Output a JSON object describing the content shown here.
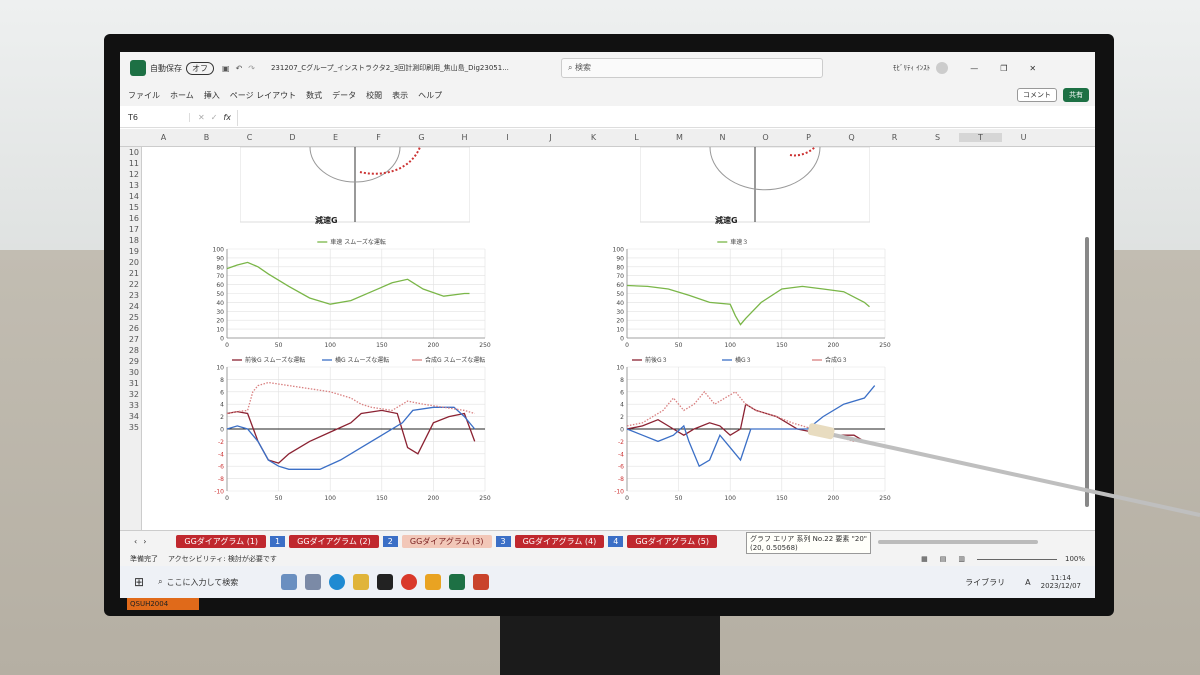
{
  "window": {
    "autosave_label": "自動保存",
    "autosave_state": "オフ",
    "file_name": "231207_Cグループ_インストラクタ2_3回計測印刷用_焦山島_Dig23051...",
    "search_placeholder": "検索",
    "user_name": "ﾓﾋﾞﾘﾃｨ ｲﾝｽﾄ",
    "comment_button": "コメント",
    "share_button": "共有"
  },
  "menu": [
    "ファイル",
    "ホーム",
    "挿入",
    "ページ レイアウト",
    "数式",
    "データ",
    "校閲",
    "表示",
    "ヘルプ"
  ],
  "formula_bar": {
    "name_box": "T6",
    "fx": "fx"
  },
  "columns": [
    "A",
    "B",
    "C",
    "D",
    "E",
    "F",
    "G",
    "H",
    "I",
    "J",
    "K",
    "L",
    "M",
    "N",
    "O",
    "P",
    "Q",
    "R",
    "S",
    "T",
    "U"
  ],
  "rows": [
    "10",
    "11",
    "12",
    "13",
    "14",
    "15",
    "16",
    "17",
    "18",
    "19",
    "20",
    "21",
    "22",
    "23",
    "24",
    "25",
    "26",
    "27",
    "28",
    "29",
    "30",
    "31",
    "32",
    "33",
    "34",
    "35"
  ],
  "charts_labels": {
    "decel_left": "減速G",
    "decel_right": "減速G",
    "speed_left_legend": "車速 スムーズな運転",
    "speed_right_legend": "車速３",
    "g_left_legend": [
      "前後G スムーズな運転",
      "横G スムーズな運転",
      "合成G スムーズな運転"
    ],
    "g_right_legend": [
      "前後G３",
      "横G３",
      "合成G３"
    ]
  },
  "sheet_tabs": [
    {
      "label": "GGダイアグラム (1)",
      "kind": "red"
    },
    {
      "label": "1",
      "kind": "blue"
    },
    {
      "label": "GGダイアグラム (2)",
      "kind": "red"
    },
    {
      "label": "2",
      "kind": "blue"
    },
    {
      "label": "GGダイアグラム (3)",
      "kind": "active"
    },
    {
      "label": "3",
      "kind": "blue"
    },
    {
      "label": "GGダイアグラム (4)",
      "kind": "red"
    },
    {
      "label": "4",
      "kind": "blue"
    },
    {
      "label": "GGダイアグラム (5)",
      "kind": "red"
    }
  ],
  "tooltip": {
    "line1": "グラフ エリア 系列 No.22 要素 \"20\"",
    "line2": "(20, 0.50568)"
  },
  "status": {
    "ready": "準備完了",
    "accessibility": "アクセシビリティ: 検討が必要です",
    "zoom": "100%"
  },
  "taskbar": {
    "search_placeholder": "ここに入力して検索",
    "library": "ライブラリ",
    "time": "11:14",
    "date": "2023/12/07",
    "ime": "A"
  },
  "badge": "QSUH2004",
  "colors": {
    "speed": "#7ab648",
    "longitudinal": "#8b2232",
    "lateral": "#3b6fc6",
    "combined": "#d98080"
  },
  "chart_data": [
    {
      "type": "line",
      "title": "",
      "series": [
        {
          "name": "車速 スムーズな運転",
          "x": [
            0,
            10,
            20,
            30,
            40,
            60,
            80,
            100,
            120,
            140,
            160,
            175,
            190,
            210,
            230,
            235
          ],
          "y": [
            78,
            82,
            85,
            80,
            72,
            58,
            45,
            38,
            42,
            52,
            62,
            66,
            55,
            47,
            50,
            50
          ]
        }
      ],
      "xlim": [
        0,
        250
      ],
      "ylim": [
        0,
        100
      ],
      "xticks": [
        0,
        50,
        100,
        150,
        200,
        250
      ],
      "yticks": [
        0,
        10,
        20,
        30,
        40,
        50,
        60,
        70,
        80,
        90,
        100
      ]
    },
    {
      "type": "line",
      "title": "",
      "series": [
        {
          "name": "前後G スムーズな運転",
          "x": [
            0,
            10,
            20,
            30,
            40,
            50,
            60,
            80,
            100,
            120,
            130,
            150,
            165,
            175,
            185,
            200,
            215,
            230,
            240
          ],
          "y": [
            2.5,
            2.8,
            2.5,
            -2,
            -5,
            -5.5,
            -4,
            -2,
            -0.5,
            1,
            2.5,
            3,
            2.5,
            -3,
            -4,
            1,
            2,
            2.5,
            -2
          ]
        },
        {
          "name": "横G スムーズな運転",
          "x": [
            0,
            10,
            20,
            30,
            40,
            50,
            60,
            70,
            90,
            110,
            130,
            150,
            170,
            180,
            200,
            220,
            230,
            240
          ],
          "y": [
            0,
            0.5,
            0,
            -2,
            -5,
            -6,
            -6.5,
            -6.5,
            -6.5,
            -5,
            -3,
            -1,
            1,
            3,
            3.5,
            3.5,
            2,
            0
          ]
        },
        {
          "name": "合成G スムーズな運転",
          "x": [
            0,
            10,
            20,
            25,
            30,
            40,
            60,
            80,
            100,
            120,
            130,
            140,
            160,
            175,
            190,
            210,
            230,
            240
          ],
          "y": [
            2.5,
            2.8,
            3,
            6,
            7,
            7.5,
            7,
            6.5,
            6,
            5,
            4,
            3.5,
            3,
            4.5,
            4,
            3.5,
            3,
            2.5
          ]
        }
      ],
      "xlim": [
        0,
        250
      ],
      "ylim": [
        -10,
        10
      ],
      "xticks": [
        0,
        50,
        100,
        150,
        200,
        250
      ],
      "yticks": [
        -10,
        -8,
        -6,
        -4,
        -2,
        0,
        2,
        4,
        6,
        8,
        10
      ]
    },
    {
      "type": "line",
      "title": "",
      "series": [
        {
          "name": "車速３",
          "x": [
            0,
            20,
            40,
            60,
            80,
            100,
            105,
            110,
            115,
            130,
            150,
            170,
            190,
            210,
            230,
            235
          ],
          "y": [
            59,
            58,
            55,
            48,
            40,
            38,
            25,
            15,
            22,
            40,
            55,
            58,
            55,
            52,
            40,
            35
          ]
        }
      ],
      "xlim": [
        0,
        250
      ],
      "ylim": [
        0,
        100
      ],
      "xticks": [
        0,
        50,
        100,
        150,
        200,
        250
      ],
      "yticks": [
        0,
        10,
        20,
        30,
        40,
        50,
        60,
        70,
        80,
        90,
        100
      ]
    },
    {
      "type": "line",
      "title": "",
      "series": [
        {
          "name": "前後G３",
          "x": [
            0,
            15,
            30,
            45,
            55,
            65,
            80,
            90,
            100,
            110,
            115,
            125,
            145,
            165,
            180,
            200,
            220,
            230
          ],
          "y": [
            0,
            0.5,
            1.5,
            0,
            -1,
            0,
            1,
            0.5,
            -1,
            0,
            4,
            3,
            2,
            0,
            -0.5,
            -1,
            -1,
            -2
          ]
        },
        {
          "name": "横G３",
          "x": [
            0,
            15,
            30,
            45,
            55,
            60,
            70,
            80,
            90,
            100,
            110,
            120,
            140,
            160,
            175,
            190,
            210,
            230,
            240
          ],
          "y": [
            0,
            -1,
            -2,
            -1,
            0.5,
            -2,
            -6,
            -5,
            -1,
            -3,
            -5,
            0,
            0,
            0,
            0,
            2,
            4,
            5,
            7
          ]
        },
        {
          "name": "合成G３",
          "x": [
            0,
            15,
            25,
            35,
            45,
            55,
            65,
            75,
            85,
            95,
            105,
            115,
            125,
            145,
            160,
            180,
            200,
            220
          ],
          "y": [
            0.5,
            1,
            2,
            3,
            5,
            3,
            4,
            6,
            4,
            5,
            6,
            4,
            3,
            2,
            1,
            0,
            -1,
            -2
          ]
        }
      ],
      "xlim": [
        0,
        250
      ],
      "ylim": [
        -10,
        10
      ],
      "xticks": [
        0,
        50,
        100,
        150,
        200,
        250
      ],
      "yticks": [
        -10,
        -8,
        -6,
        -4,
        -2,
        0,
        2,
        4,
        6,
        8,
        10
      ]
    }
  ]
}
